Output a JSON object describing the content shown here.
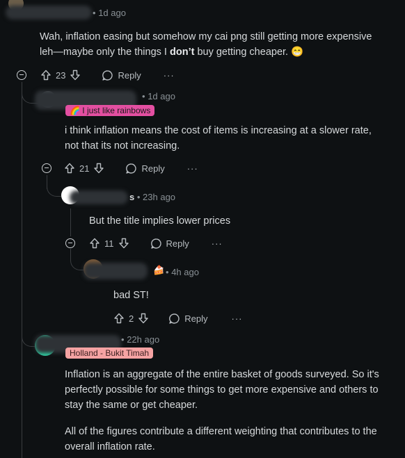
{
  "comments": [
    {
      "time": "1d ago",
      "body_pre": "Wah, inflation easing but somehow my cai png still getting more expensive leh—maybe only the things I ",
      "body_bold": "don’t",
      "body_post": " buy getting cheaper.",
      "emoji": "😁",
      "votes": "23",
      "reply_label": "Reply",
      "more": "···"
    },
    {
      "time": "1d ago",
      "flair": "🌈 I just like rainbows",
      "body": "i think inflation means the cost of items is increasing at a slower rate, not that its not increasing.",
      "votes": "21",
      "reply_label": "Reply",
      "more": "···"
    },
    {
      "name_suffix": "s",
      "time": "23h ago",
      "body": "But the title implies lower prices",
      "votes": "11",
      "reply_label": "Reply",
      "more": "···"
    },
    {
      "time": "4h ago",
      "body": "bad ST!",
      "votes": "2",
      "reply_label": "Reply",
      "more": "···"
    },
    {
      "time": "22h ago",
      "flair": "Holland - Bukit Timah",
      "body_p1": "Inflation is an aggregate of the entire basket of goods surveyed. So it's perfectly possible for some things to get more expensive and others to stay the same or get cheaper.",
      "body_p2": "All of the figures contribute a different weighting that contributes to the overall inflation rate."
    }
  ],
  "meta_sep": "•",
  "colors": {
    "background": "#0e1113",
    "rainbow_flair": "#e34fa1",
    "holland_flair": "#f5a3a3",
    "thread_line": "#3a3d40"
  }
}
